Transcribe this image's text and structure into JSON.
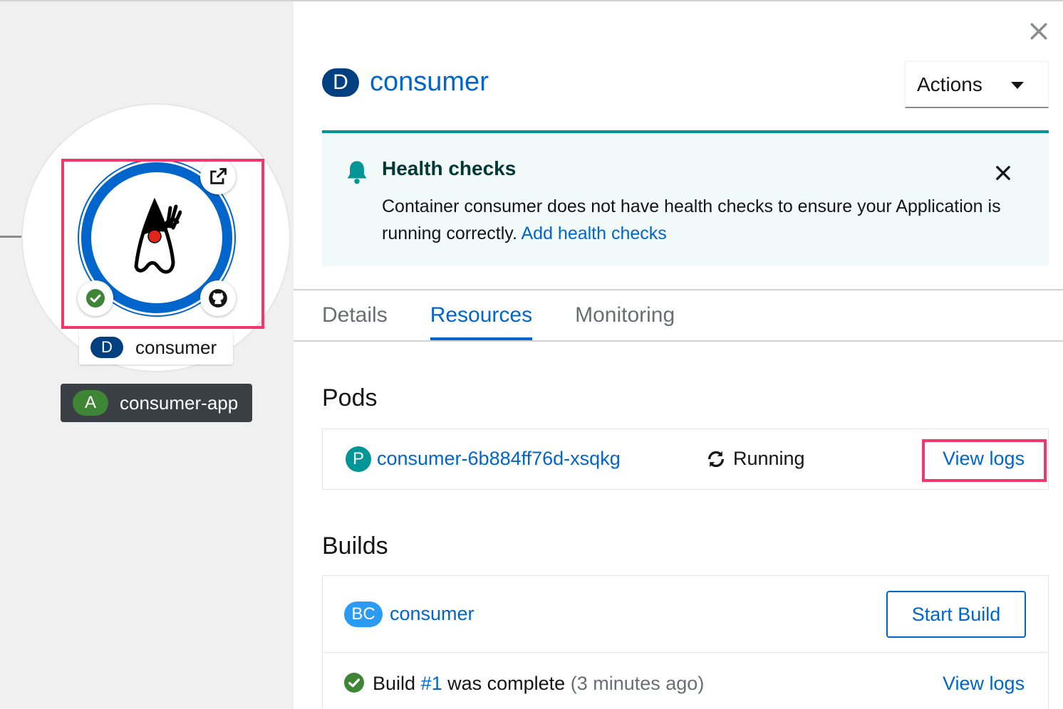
{
  "topology": {
    "node": {
      "badge": "D",
      "name": "consumer"
    },
    "application": {
      "badge": "A",
      "name": "consumer-app"
    },
    "icons": {
      "runtime": "java-duke-icon",
      "link": "external-link-icon",
      "status": "check-circle-icon",
      "source": "github-icon"
    }
  },
  "panel": {
    "header": {
      "badge": "D",
      "title": "consumer"
    },
    "actions_label": "Actions",
    "alert": {
      "title": "Health checks",
      "body": "Container consumer does not have health checks to ensure your Application is running correctly.",
      "link": "Add health checks"
    },
    "tabs": [
      {
        "label": "Details",
        "active": false
      },
      {
        "label": "Resources",
        "active": true
      },
      {
        "label": "Monitoring",
        "active": false
      }
    ],
    "pods": {
      "heading": "Pods",
      "items": [
        {
          "badge": "P",
          "name": "consumer-6b884ff76d-xsqkg",
          "status": "Running",
          "action": "View logs"
        }
      ]
    },
    "builds": {
      "heading": "Builds",
      "config": {
        "badge": "BC",
        "name": "consumer",
        "action": "Start Build"
      },
      "latest": {
        "prefix": "Build",
        "number": "#1",
        "middle": "was complete",
        "time": "(3 minutes ago)",
        "action": "View logs"
      }
    }
  },
  "colors": {
    "brand_blue": "#0066cc",
    "deployment_badge": "#004080",
    "app_badge": "#3e8635",
    "pod_badge": "#009596",
    "bc_badge": "#2b9af3",
    "highlight": "#f0386b",
    "alert_bg": "#f2f9f9",
    "alert_border": "#009596"
  }
}
